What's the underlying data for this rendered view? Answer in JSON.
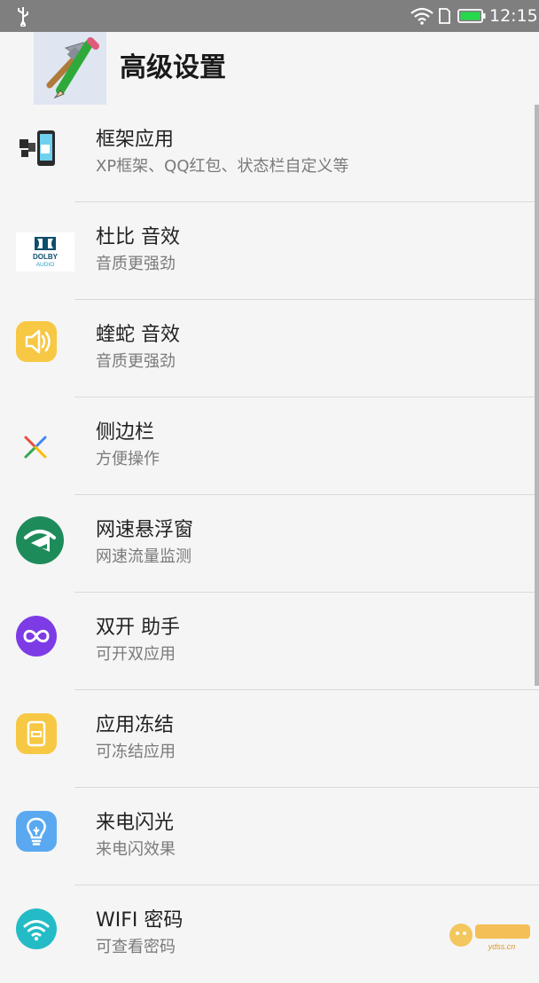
{
  "status_bar": {
    "time": "12:15"
  },
  "header": {
    "title": "高级设置"
  },
  "items": [
    {
      "title": "框架应用",
      "subtitle": "XP框架、QQ红包、状态栏自定义等"
    },
    {
      "title": "杜比 音效",
      "subtitle": "音质更强劲",
      "icon_text": "DOLBY",
      "icon_text2": "AUDIO"
    },
    {
      "title": "蝰蛇 音效",
      "subtitle": "音质更强劲"
    },
    {
      "title": "侧边栏",
      "subtitle": "方便操作"
    },
    {
      "title": "网速悬浮窗",
      "subtitle": "网速流量监测"
    },
    {
      "title": "双开 助手",
      "subtitle": "可开双应用"
    },
    {
      "title": "应用冻结",
      "subtitle": "可冻结应用"
    },
    {
      "title": "来电闪光",
      "subtitle": "来电闪效果"
    },
    {
      "title": "WIFI 密码",
      "subtitle": "可查看密码"
    }
  ],
  "watermark": {
    "text": "ydss.cn"
  },
  "colors": {
    "statusbar": "#7f7f7f",
    "yellow_icon": "#f7c843",
    "green_icon": "#1e8c5a",
    "purple_icon": "#7d3be6",
    "blue_icon": "#5aa9f0",
    "teal_icon": "#23bcc6"
  }
}
